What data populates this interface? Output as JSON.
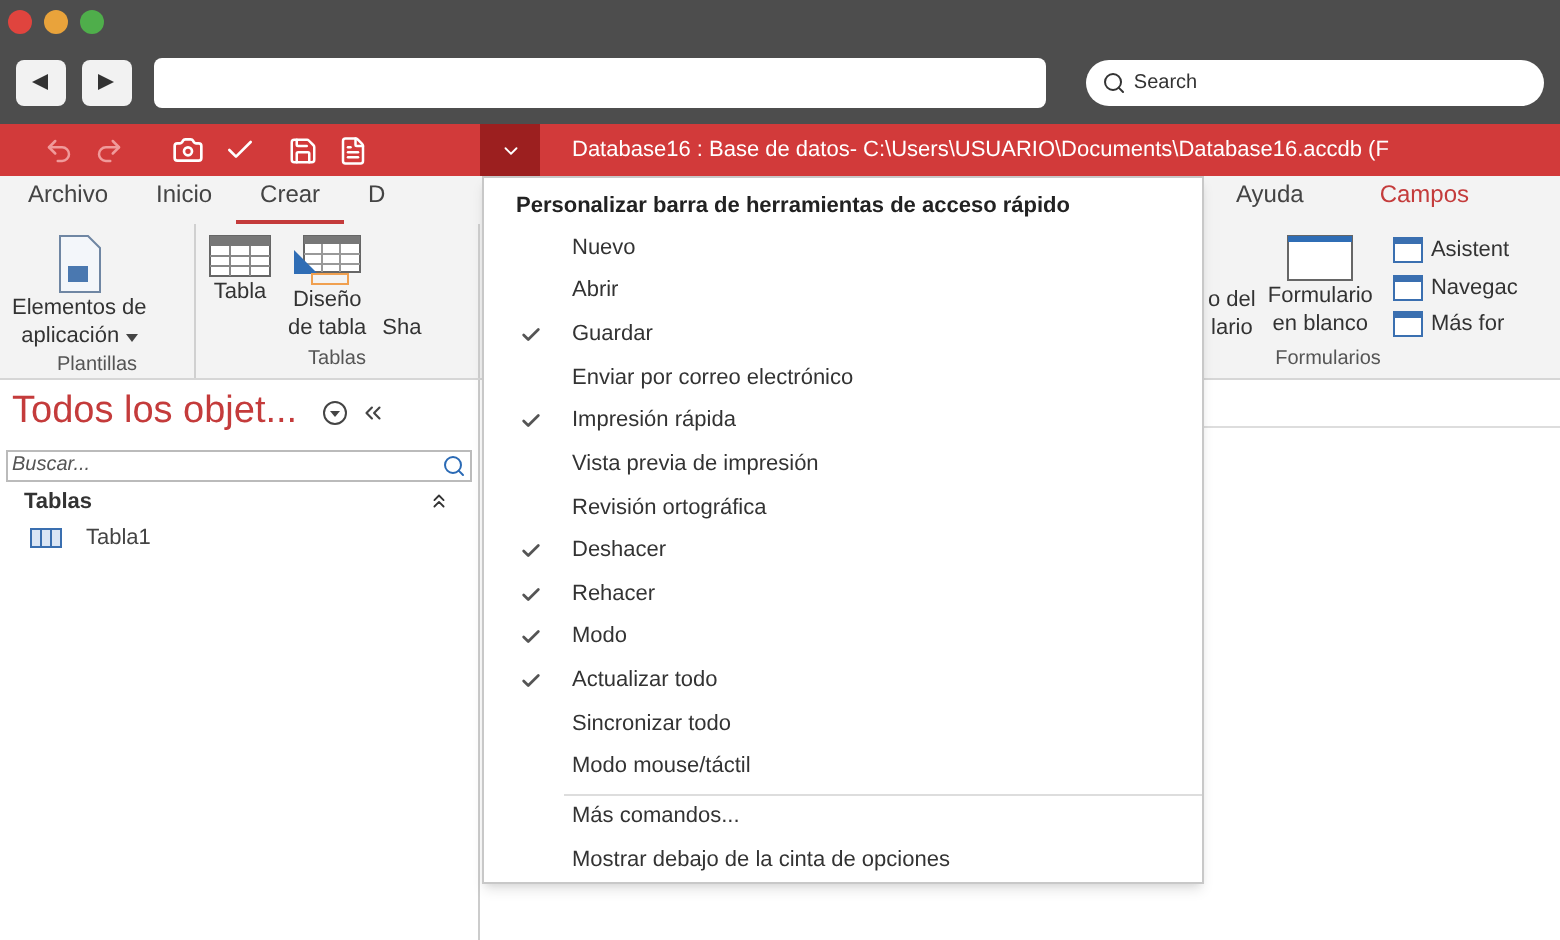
{
  "browser": {
    "search": {
      "placeholder": "Search"
    }
  },
  "title_bar": {
    "title": "Database16 : Base de datos- C:\\Users\\USUARIO\\Documents\\Database16.accdb (F",
    "qat_dropdown": {
      "expanded": true
    }
  },
  "ribbon": {
    "tabs": [
      {
        "label": "Archivo",
        "selected": false,
        "kind": "normal"
      },
      {
        "label": "Inicio",
        "selected": false,
        "kind": "normal"
      },
      {
        "label": "Crear",
        "selected": true,
        "kind": "normal"
      },
      {
        "label": "D",
        "selected": false,
        "kind": "normal"
      }
    ],
    "right_tabs": [
      {
        "label": "Ayuda",
        "selected": false,
        "kind": "normal"
      },
      {
        "label": "Campos",
        "selected": false,
        "kind": "contextual"
      }
    ],
    "left_groups": [
      {
        "label": "Plantillas",
        "buttons": [
          {
            "lines": [
              "Elementos de",
              "aplicación"
            ],
            "dropdown": true,
            "kind": "app"
          }
        ]
      },
      {
        "label": "Tablas",
        "buttons": [
          {
            "lines": [
              "Tabla"
            ],
            "dropdown": false,
            "kind": "table"
          },
          {
            "lines": [
              "Diseño",
              "de tabla"
            ],
            "dropdown": false,
            "kind": "design"
          },
          {
            "lines": [
              "Sha"
            ],
            "dropdown": false,
            "kind": "cut"
          }
        ]
      }
    ],
    "right_group": {
      "label": "Formularios",
      "buttons": [
        {
          "lines": [
            "o del",
            "lario"
          ],
          "kind": "cut"
        },
        {
          "lines": [
            "Formulario",
            "en blanco"
          ],
          "kind": "form"
        }
      ],
      "small_items": [
        {
          "label": "Asistent"
        },
        {
          "label": "Navegac"
        },
        {
          "label": "Más for"
        }
      ]
    }
  },
  "nav": {
    "title": "Todos los objet...",
    "search": {
      "placeholder": "Buscar..."
    },
    "sections": [
      {
        "label": "Tablas",
        "expanded": true,
        "items": [
          {
            "label": "Tabla1"
          }
        ]
      }
    ]
  },
  "menu": {
    "title": "Personalizar barra de herramientas de acceso rápido",
    "items": [
      {
        "label": "Nuevo",
        "checked": false
      },
      {
        "label": "Abrir",
        "checked": false
      },
      {
        "label": "Guardar",
        "checked": true
      },
      {
        "label": "Enviar por correo electrónico",
        "checked": false
      },
      {
        "label": "Impresión rápida",
        "checked": true
      },
      {
        "label": "Vista previa de impresión",
        "checked": false
      },
      {
        "label": "Revisión ortográfica",
        "checked": false
      },
      {
        "label": "Deshacer",
        "checked": true
      },
      {
        "label": "Rehacer",
        "checked": true
      },
      {
        "label": "Modo",
        "checked": true
      },
      {
        "label": "Actualizar todo",
        "checked": true
      },
      {
        "label": "Sincronizar todo",
        "checked": false
      },
      {
        "label": "Modo mouse/táctil",
        "checked": false
      }
    ],
    "commands": [
      {
        "label": "Más comandos..."
      },
      {
        "label": "Mostrar debajo de la cinta de opciones"
      }
    ]
  }
}
